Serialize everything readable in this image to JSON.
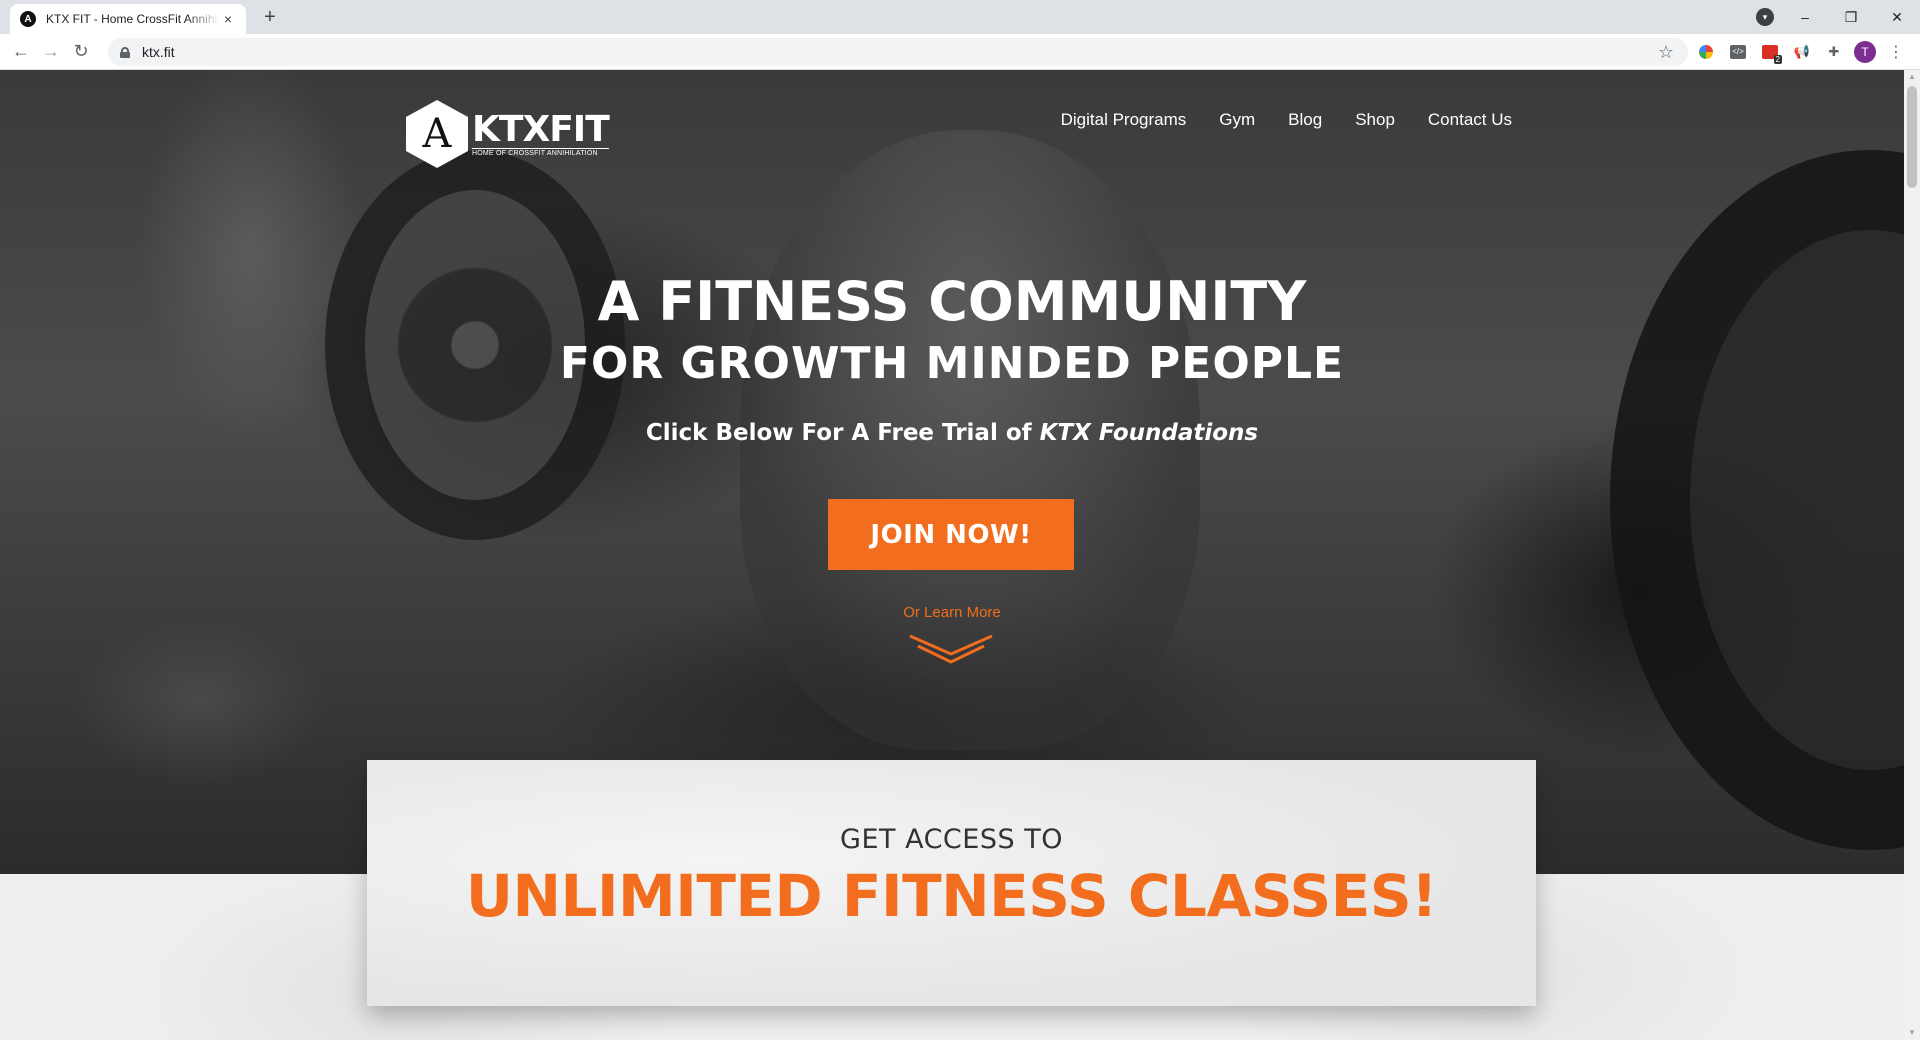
{
  "browser": {
    "tab_title": "KTX FIT - Home CrossFit Annihilation",
    "tab_favicon": "A",
    "url": "ktx.fit",
    "new_tab": "+",
    "close_tab": "×",
    "minimize": "–",
    "restore": "❐",
    "close": "✕",
    "avatar_initial": "T",
    "extension_badge": "2"
  },
  "site": {
    "logo": {
      "mark": "A",
      "word": "KTXFIT",
      "tagline": "HOME OF CROSSFIT ANNIHILATION"
    },
    "nav": [
      {
        "label": "Digital Programs"
      },
      {
        "label": "Gym"
      },
      {
        "label": "Blog"
      },
      {
        "label": "Shop"
      },
      {
        "label": "Contact Us"
      }
    ],
    "hero": {
      "headline_1": "A FITNESS COMMUNITY",
      "headline_2": "FOR GROWTH MINDED PEOPLE",
      "subline_prefix": "Click Below For A Free Trial of ",
      "subline_emphasis": "KTX Foundations",
      "cta": "JOIN NOW!",
      "learn_more": "Or Learn More"
    },
    "card": {
      "subtitle": "GET ACCESS TO",
      "title": "UNLIMITED FITNESS CLASSES!"
    },
    "colors": {
      "accent": "#f26d1d"
    }
  }
}
